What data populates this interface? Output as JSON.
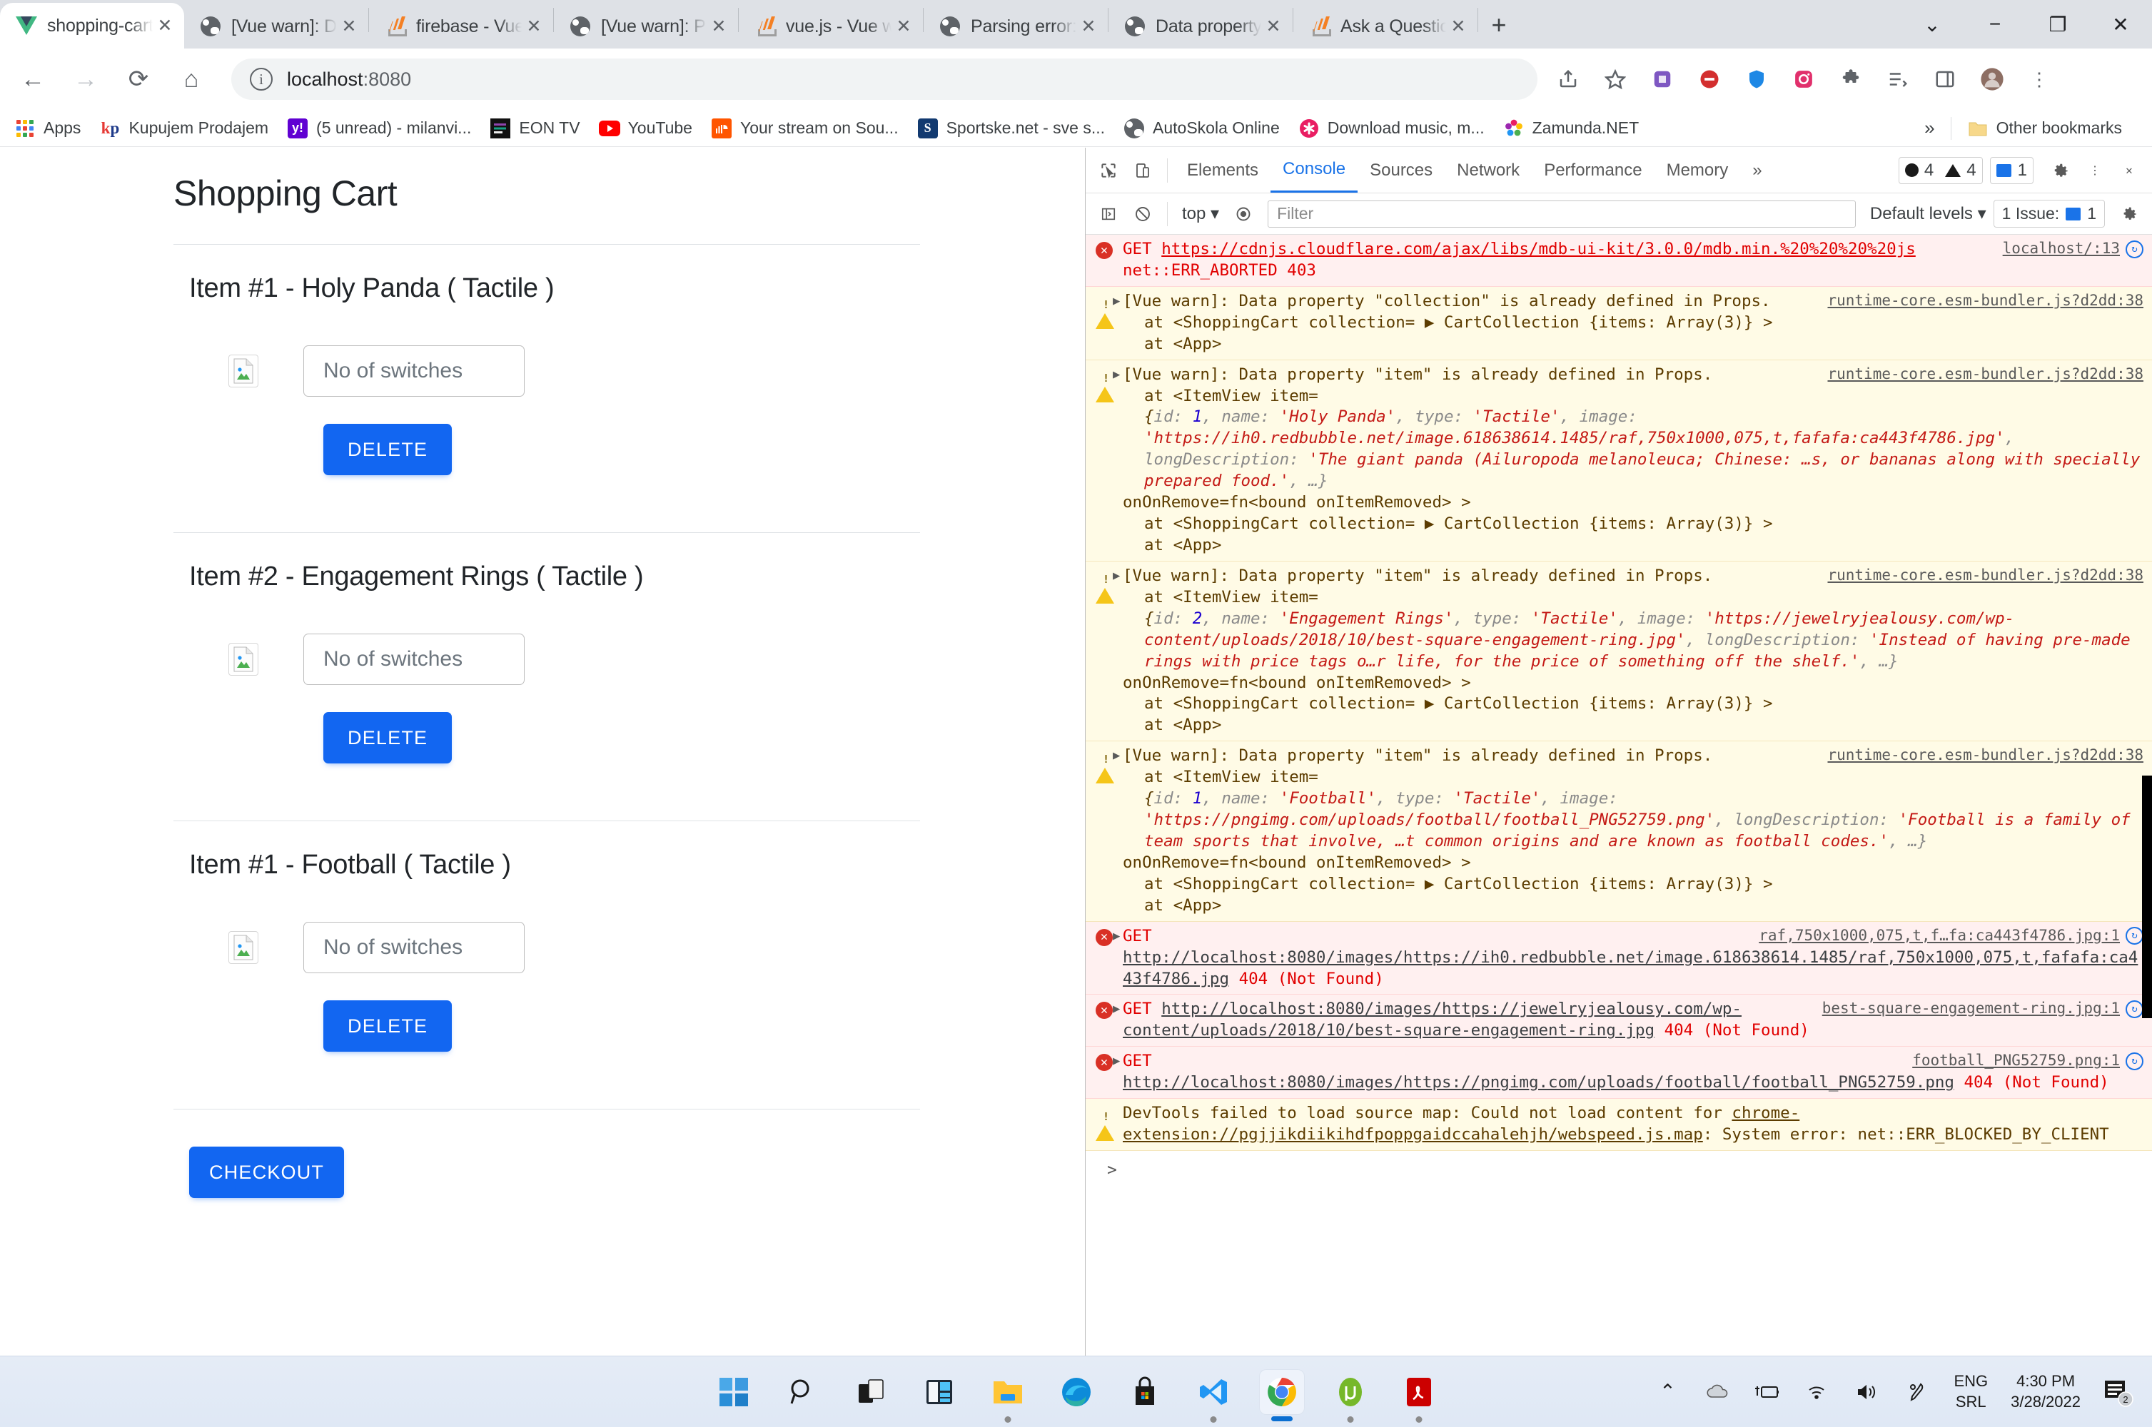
{
  "browser": {
    "tabs": [
      {
        "label": "shopping-cart",
        "icon": "vue-icon",
        "active": true
      },
      {
        "label": "[Vue warn]: Data",
        "icon": "globe-icon",
        "active": false
      },
      {
        "label": "firebase - Vue wa",
        "icon": "stackoverflow-icon",
        "active": false
      },
      {
        "label": "[Vue warn]: Prop",
        "icon": "globe-icon",
        "active": false
      },
      {
        "label": "vue.js - Vue warn",
        "icon": "stackoverflow-icon",
        "active": false
      },
      {
        "label": "Parsing error: Un",
        "icon": "globe-icon",
        "active": false
      },
      {
        "label": "Data property \"c",
        "icon": "globe-icon",
        "active": false
      },
      {
        "label": "Ask a Question -",
        "icon": "stackoverflow-icon",
        "active": false
      }
    ],
    "new_tab_label": "+",
    "window_controls": [
      "chevron-down",
      "minimize",
      "maximize",
      "close"
    ],
    "nav": {
      "back": "←",
      "forward": "→",
      "reload": "⟳",
      "home": "⌂",
      "url_main": "localhost",
      "url_port": ":8080",
      "site_info_icon": "info-icon"
    },
    "bookmarks": [
      {
        "label": "Apps",
        "icon": "apps-grid-icon"
      },
      {
        "label": "Kupujem Prodajem",
        "icon": "kp-icon"
      },
      {
        "label": "(5 unread) - milanvi...",
        "icon": "yahoo-icon"
      },
      {
        "label": "EON TV",
        "icon": "eon-icon"
      },
      {
        "label": "YouTube",
        "icon": "youtube-icon"
      },
      {
        "label": "Your stream on Sou...",
        "icon": "soundcloud-icon"
      },
      {
        "label": "Sportske.net - sve s...",
        "icon": "sportske-icon"
      },
      {
        "label": "AutoSkola Online",
        "icon": "globe-icon"
      },
      {
        "label": "Download music, m...",
        "icon": "asterisk-icon"
      },
      {
        "label": "Zamunda.NET",
        "icon": "zamunda-icon"
      }
    ],
    "bookmarks_overflow": "»",
    "other_bookmarks": "Other bookmarks"
  },
  "page": {
    "title": "Shopping Cart",
    "items": [
      {
        "heading": "Item #1 - Holy Panda ( Tactile )",
        "qty_placeholder": "No of switches",
        "qty_value": "",
        "delete_label": "DELETE"
      },
      {
        "heading": "Item #2 - Engagement Rings ( Tactile )",
        "qty_placeholder": "No of switches",
        "qty_value": "",
        "delete_label": "DELETE"
      },
      {
        "heading": "Item #1 - Football ( Tactile )",
        "qty_placeholder": "No of switches",
        "qty_value": "",
        "delete_label": "DELETE"
      }
    ],
    "checkout_label": "CHECKOUT",
    "primary_color": "#1266f1"
  },
  "devtools": {
    "tabs": [
      "Elements",
      "Console",
      "Sources",
      "Network",
      "Performance",
      "Memory"
    ],
    "tabs_overflow": "»",
    "selected_tab": "Console",
    "error_count": "4",
    "warning_count": "4",
    "message_count": "1",
    "filterbar": {
      "context": "top",
      "filter_placeholder": "Filter",
      "levels": "Default levels",
      "issues_label": "1 Issue:",
      "issues_count": "1"
    },
    "prompt": ">",
    "messages": [
      {
        "type": "error",
        "method": "GET",
        "url": "https://cdnjs.cloudflare.com/ajax/libs/mdb-ui-kit/3.0.0/mdb.min.%20%20%20%20js",
        "tail": "net::ERR_ABORTED 403",
        "source": "localhost/:13"
      },
      {
        "type": "warning",
        "text": "[Vue warn]: Data property \"collection\" is already defined in Props.",
        "source": "runtime-core.esm-bundler.js?d2dd:38",
        "stack": [
          "at <ShoppingCart collection= ▶ CartCollection {items: Array(3)} >",
          "at <App>"
        ]
      },
      {
        "type": "warning",
        "text": "[Vue warn]: Data property \"item\" is already defined in Props.",
        "source": "runtime-core.esm-bundler.js?d2dd:38",
        "at_line": "at <ItemView item=",
        "obj_id": "1",
        "obj_name": "Holy Panda",
        "obj_type": "Tactile",
        "obj_image": "https://ih0.redbubble.net/image.618638614.1485/raf,750x1000,075,t,fafafa:ca443f4786.jpg",
        "obj_desc": "The giant panda (Ailuropoda melanoleuca; Chinese: …s, or bananas along with specially prepared food.",
        "bound": "onOnRemove=fn<bound onItemRemoved> >",
        "stack": [
          "at <ShoppingCart collection= ▶ CartCollection {items: Array(3)} >",
          "at <App>"
        ]
      },
      {
        "type": "warning",
        "text": "[Vue warn]: Data property \"item\" is already defined in Props.",
        "source": "runtime-core.esm-bundler.js?d2dd:38",
        "at_line": "at <ItemView item=",
        "obj_id": "2",
        "obj_name": "Engagement Rings",
        "obj_type": "Tactile",
        "obj_image": "https://jewelryjealousy.com/wp-content/uploads/2018/10/best-square-engagement-ring.jpg",
        "obj_desc": "Instead of having pre-made rings with price tags o…r life, for the price of something off the shelf.",
        "bound": "onOnRemove=fn<bound onItemRemoved> >",
        "stack": [
          "at <ShoppingCart collection= ▶ CartCollection {items: Array(3)} >",
          "at <App>"
        ]
      },
      {
        "type": "warning",
        "text": "[Vue warn]: Data property \"item\" is already defined in Props.",
        "source": "runtime-core.esm-bundler.js?d2dd:38",
        "at_line": "at <ItemView item=",
        "obj_id": "1",
        "obj_name": "Football",
        "obj_type": "Tactile",
        "obj_image": "https://pngimg.com/uploads/football/football_PNG52759.png",
        "obj_desc": "Football is a family of team sports that involve, …t common origins and are known as football codes.",
        "bound": "onOnRemove=fn<bound onItemRemoved> >",
        "stack": [
          "at <ShoppingCart collection= ▶ CartCollection {items: Array(3)} >",
          "at <App>"
        ]
      },
      {
        "type": "error",
        "method": "GET",
        "url": "http://localhost:8080/images/https://ih0.redbubble.net/image.618638614.1485/raf,750x1000,075,t,fafafa:ca443f4786.jpg",
        "status": "404 (Not Found)",
        "source": "raf,750x1000,075,t,f…fa:ca443f4786.jpg:1"
      },
      {
        "type": "error",
        "method": "GET",
        "url": "http://localhost:8080/images/https://jewelryjealousy.com/wp-content/uploads/2018/10/best-square-engagement-ring.jpg",
        "status": "404 (Not Found)",
        "source": "best-square-engagement-ring.jpg:1"
      },
      {
        "type": "error",
        "method": "GET",
        "url": "http://localhost:8080/images/https://pngimg.com/uploads/football/football_PNG52759.png",
        "status": "404 (Not Found)",
        "source": "football_PNG52759.png:1"
      },
      {
        "type": "warning",
        "text_prefix": "DevTools failed to load source map: Could not load content for ",
        "link": "chrome-extension://pgjjikdiikihdfpoppgaidccahalehjh/webspeed.js.map",
        "text_suffix": ": System error: net::ERR_BLOCKED_BY_CLIENT"
      }
    ]
  },
  "taskbar": {
    "apps": [
      {
        "name": "start-button"
      },
      {
        "name": "search-icon"
      },
      {
        "name": "task-view-icon"
      },
      {
        "name": "widgets-icon"
      },
      {
        "name": "file-explorer-icon"
      },
      {
        "name": "edge-icon"
      },
      {
        "name": "microsoft-store-icon"
      },
      {
        "name": "vscode-icon"
      },
      {
        "name": "chrome-icon"
      },
      {
        "name": "utorrent-icon"
      },
      {
        "name": "acrobat-icon"
      }
    ],
    "tray": {
      "lang_top": "ENG",
      "lang_bottom": "SRL",
      "time": "4:30 PM",
      "date": "3/28/2022",
      "notification_count": "2"
    }
  }
}
